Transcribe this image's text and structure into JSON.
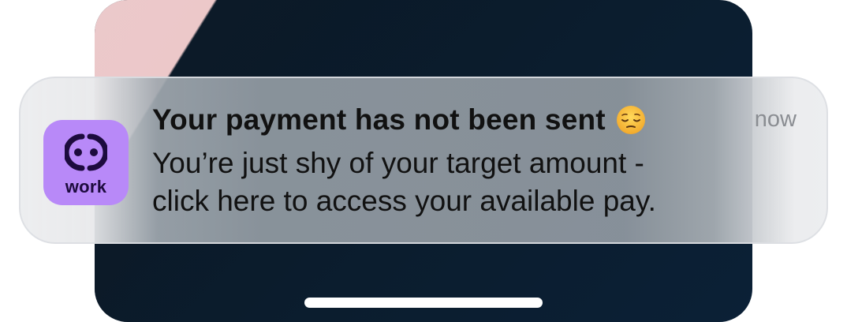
{
  "notification": {
    "app_name": "work",
    "title": "Your payment has not been sent",
    "title_emoji": "pensive-face-icon",
    "time": "now",
    "body_lines": [
      "You’re just shy of your target amount -",
      "click here to access your available pay."
    ]
  },
  "colors": {
    "app_icon_background": "#b889f8",
    "app_icon_foreground": "#1d0b3e",
    "wallpaper_dark": "#0b1d2e",
    "wallpaper_pink": "#ecc8c9"
  }
}
